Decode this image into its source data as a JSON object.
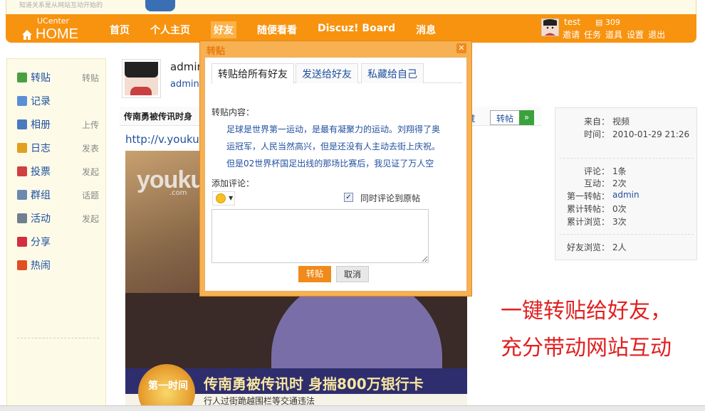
{
  "top_banner": {
    "text": "知道关系是从网站互动开始的"
  },
  "navbar": {
    "brand_small": "UCenter",
    "brand_big": "HOME",
    "items": [
      {
        "label": "首页"
      },
      {
        "label": "个人主页"
      },
      {
        "label": "好友"
      },
      {
        "label": "随便看看"
      },
      {
        "label": "Discuz! Board"
      },
      {
        "label": "消息"
      }
    ],
    "active_index": 2,
    "user": {
      "name": "test",
      "credits": "309",
      "links": [
        "邀请",
        "任务",
        "道具",
        "设置",
        "退出"
      ]
    }
  },
  "sidebar": {
    "items": [
      {
        "label": "转贴",
        "sub": "转贴",
        "icon": "share-post-icon",
        "color": "#4aa040"
      },
      {
        "label": "记录",
        "sub": "",
        "icon": "chat-bubble-icon",
        "color": "#5b8fd6"
      },
      {
        "label": "相册",
        "sub": "上传",
        "icon": "photo-album-icon",
        "color": "#4a7ac0"
      },
      {
        "label": "日志",
        "sub": "发表",
        "icon": "notebook-icon",
        "color": "#e0a020"
      },
      {
        "label": "投票",
        "sub": "发起",
        "icon": "poll-chart-icon",
        "color": "#d04040"
      },
      {
        "label": "群组",
        "sub": "话题",
        "icon": "group-icon",
        "color": "#6a8ab0"
      },
      {
        "label": "活动",
        "sub": "发起",
        "icon": "calendar-icon",
        "color": "#708090"
      },
      {
        "label": "分享",
        "sub": "",
        "icon": "heart-share-icon",
        "color": "#d03040"
      },
      {
        "label": "热闹",
        "sub": "",
        "icon": "fire-icon",
        "color": "#e05020"
      }
    ]
  },
  "post": {
    "username": "admin",
    "username_link": "admin",
    "title": "传南勇被传讯时身",
    "fav_label": "藏",
    "share_button": "转帖",
    "url": "http://v.youku",
    "video": {
      "watermark": "youku",
      "watermark_sub": ".com",
      "ticker": "传南勇被传讯时  身揣800万银行卡",
      "ticker2": "行人过街跪越围栏等交通违法",
      "logo": "第一时间"
    }
  },
  "info_panel": {
    "rows": [
      {
        "k": "来自：",
        "v": "视频"
      },
      {
        "k": "时间：",
        "v": "2010-01-29 21:26"
      },
      {
        "k": "评论：",
        "v": "1条"
      },
      {
        "k": "互动：",
        "v": "2次"
      },
      {
        "k": "第一转帖：",
        "v": "admin"
      },
      {
        "k": "累计转帖：",
        "v": "0次"
      },
      {
        "k": "累计浏览：",
        "v": "3次"
      },
      {
        "k": "好友浏览：",
        "v": "2人"
      }
    ]
  },
  "promo": {
    "line1": "一键转贴给好友，",
    "line2": "充分带动网站互动"
  },
  "modal": {
    "title": "转贴",
    "tabs": [
      "转贴给所有好友",
      "发送给好友",
      "私藏给自己"
    ],
    "content_label": "转贴内容：",
    "content_lines": [
      "足球是世界第一运动，是最有凝聚力的运动。刘翔得了奥",
      "运冠军，人民当然高兴，但是还没有人主动去街上庆祝。",
      "但是02世界杯国足出线的那场比赛后，我见证了万人空"
    ],
    "comment_label": "添加评论：",
    "sync_label": "同时评论到原帖",
    "sync_checked": true,
    "comment_value": "",
    "submit_label": "转贴",
    "cancel_label": "取消"
  }
}
